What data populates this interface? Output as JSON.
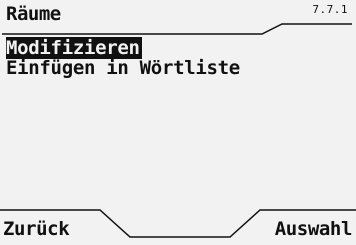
{
  "header": {
    "title": "Räume",
    "index": "7.7.1"
  },
  "menu": {
    "items": [
      {
        "label": "Modifizieren",
        "selected": true
      },
      {
        "label": "Einfügen in Wörtliste",
        "selected": false
      }
    ]
  },
  "softkeys": {
    "left": "Zurück",
    "right": "Auswahl"
  },
  "colors": {
    "background": "#f2f2f2",
    "foreground": "#111111"
  }
}
